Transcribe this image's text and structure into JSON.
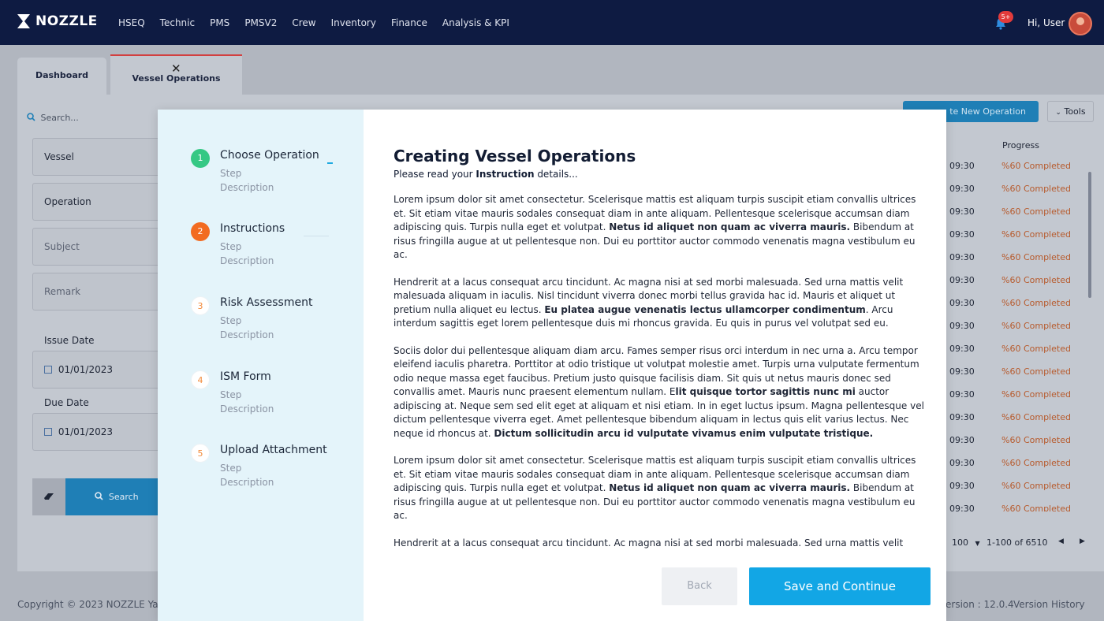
{
  "topbar": {
    "logo": "NOZZLE",
    "nav": [
      "HSEQ",
      "Technic",
      "PMS",
      "PMSV2",
      "Crew",
      "Inventory",
      "Finance",
      "Analysis & KPI"
    ],
    "notifications_badge": "5+",
    "greeting": "Hi, User"
  },
  "tabs": {
    "dashboard": "Dashboard",
    "vessel_ops": "Vessel Operations",
    "close_glyph": "✕"
  },
  "filters": {
    "search_placeholder": "Search...",
    "vessel": "Vessel",
    "operation": "Operation",
    "subject": "Subject",
    "remark": "Remark",
    "issue_date_label": "Issue Date",
    "issue_date": "01/01/2023",
    "due_date_label": "Due Date",
    "due_date": "01/01/2023",
    "search_button": "Search"
  },
  "toolbar": {
    "create_label": "te New Operation",
    "tools_label": "Tools"
  },
  "table": {
    "progress_header": "Progress",
    "rows": [
      {
        "time": "09:30",
        "progress": "%60 Completed"
      },
      {
        "time": "09:30",
        "progress": "%60 Completed"
      },
      {
        "time": "09:30",
        "progress": "%60 Completed"
      },
      {
        "time": "09:30",
        "progress": "%60 Completed"
      },
      {
        "time": "09:30",
        "progress": "%60 Completed"
      },
      {
        "time": "09:30",
        "progress": "%60 Completed"
      },
      {
        "time": "09:30",
        "progress": "%60 Completed"
      },
      {
        "time": "09:30",
        "progress": "%60 Completed"
      },
      {
        "time": "09:30",
        "progress": "%60 Completed"
      },
      {
        "time": "09:30",
        "progress": "%60 Completed"
      },
      {
        "time": "09:30",
        "progress": "%60 Completed"
      },
      {
        "time": "09:30",
        "progress": "%60 Completed"
      },
      {
        "time": "09:30",
        "progress": "%60 Completed"
      },
      {
        "time": "09:30",
        "progress": "%60 Completed"
      },
      {
        "time": "09:30",
        "progress": "%60 Completed"
      },
      {
        "time": "09:30",
        "progress": "%60 Completed"
      }
    ],
    "page_size": "100",
    "range": "1-100 of 6510"
  },
  "footer": {
    "copyright": "Copyright © 2023  NOZZLE Ya",
    "version": "ersion : 12.0.4",
    "version_history": "Version History"
  },
  "dialog": {
    "steps": [
      {
        "num": "1",
        "title": "Choose Operation",
        "sub1": "Step",
        "sub2": "Description",
        "state": "done"
      },
      {
        "num": "2",
        "title": "Instructions",
        "sub1": "Step",
        "sub2": "Description",
        "state": "active"
      },
      {
        "num": "3",
        "title": "Risk Assessment",
        "sub1": "Step",
        "sub2": "Description",
        "state": "pending"
      },
      {
        "num": "4",
        "title": "ISM Form",
        "sub1": "Step",
        "sub2": "Description",
        "state": "pending"
      },
      {
        "num": "5",
        "title": "Upload Attachment",
        "sub1": "Step",
        "sub2": "Description",
        "state": "pending"
      }
    ],
    "title": "Creating Vessel Operations",
    "subtitle_pre": "Please read your ",
    "subtitle_bold": "Instruction",
    "subtitle_post": " details...",
    "paragraphs": [
      {
        "pre": "Lorem ipsum dolor sit amet consectetur. Scelerisque mattis est aliquam turpis suscipit etiam convallis ultrices et. Sit etiam vitae mauris sodales consequat diam in ante aliquam. Pellentesque scelerisque accumsan diam adipiscing quis. Turpis nulla eget et volutpat. ",
        "bold": "Netus id aliquet non quam ac viverra mauris.",
        "post": " Bibendum at risus fringilla augue at ut pellentesque non. Dui eu porttitor auctor commodo venenatis magna vestibulum eu ac."
      },
      {
        "pre": "Hendrerit at a lacus consequat arcu tincidunt. Ac magna nisi at sed morbi malesuada. Sed urna mattis velit malesuada aliquam in iaculis. Nisl tincidunt viverra donec morbi tellus gravida hac id. Mauris et aliquet ut pretium nulla aliquet eu lectus. ",
        "bold": "Eu platea augue venenatis lectus ullamcorper condimentum",
        "post": ". Arcu interdum sagittis eget lorem pellentesque duis mi rhoncus gravida. Eu quis in purus vel volutpat sed eu."
      },
      {
        "pre": "Sociis dolor dui pellentesque aliquam diam arcu. Fames semper risus orci interdum in nec urna a. Arcu tempor eleifend iaculis pharetra. Porttitor at odio tristique ut volutpat molestie amet. Turpis urna vulputate fermentum odio neque massa eget faucibus. Pretium justo quisque facilisis diam. Sit quis ut netus mauris donec sed convallis amet. Mauris nunc praesent elementum nullam. E",
        "bold": "lit quisque tortor sagittis nunc mi",
        "post": " auctor adipiscing at. Neque sem sed elit eget at aliquam et nisi etiam. In in eget luctus ipsum. Magna pellentesque vel dictum pellentesque viverra eget. Amet pellentesque bibendum aliquam in lectus quis elit varius lectus. Nec neque id rhoncus at. ",
        "bold2": "Dictum sollicitudin arcu id vulputate vivamus enim vulputate tristique."
      },
      {
        "pre": "Lorem ipsum dolor sit amet consectetur. Scelerisque mattis est aliquam turpis suscipit etiam convallis ultrices et. Sit etiam vitae mauris sodales consequat diam in ante aliquam. Pellentesque scelerisque accumsan diam adipiscing quis. Turpis nulla eget et volutpat. ",
        "bold": "Netus id aliquet non quam ac viverra mauris.",
        "post": " Bibendum at risus fringilla augue at ut pellentesque non. Dui eu porttitor auctor commodo venenatis magna vestibulum eu ac."
      },
      {
        "pre": "Hendrerit at a lacus consequat arcu tincidunt. Ac magna nisi at sed morbi malesuada. Sed urna mattis velit malesuada aliquam in iaculis. Nisl tincidunt viverra donec morbi tellus gravida hac id. Mauris et aliquet ut pretium nulla aliquet eu lectus.",
        "bold": "",
        "post": ""
      }
    ],
    "back_label": "Back",
    "save_label": "Save and Continue"
  }
}
